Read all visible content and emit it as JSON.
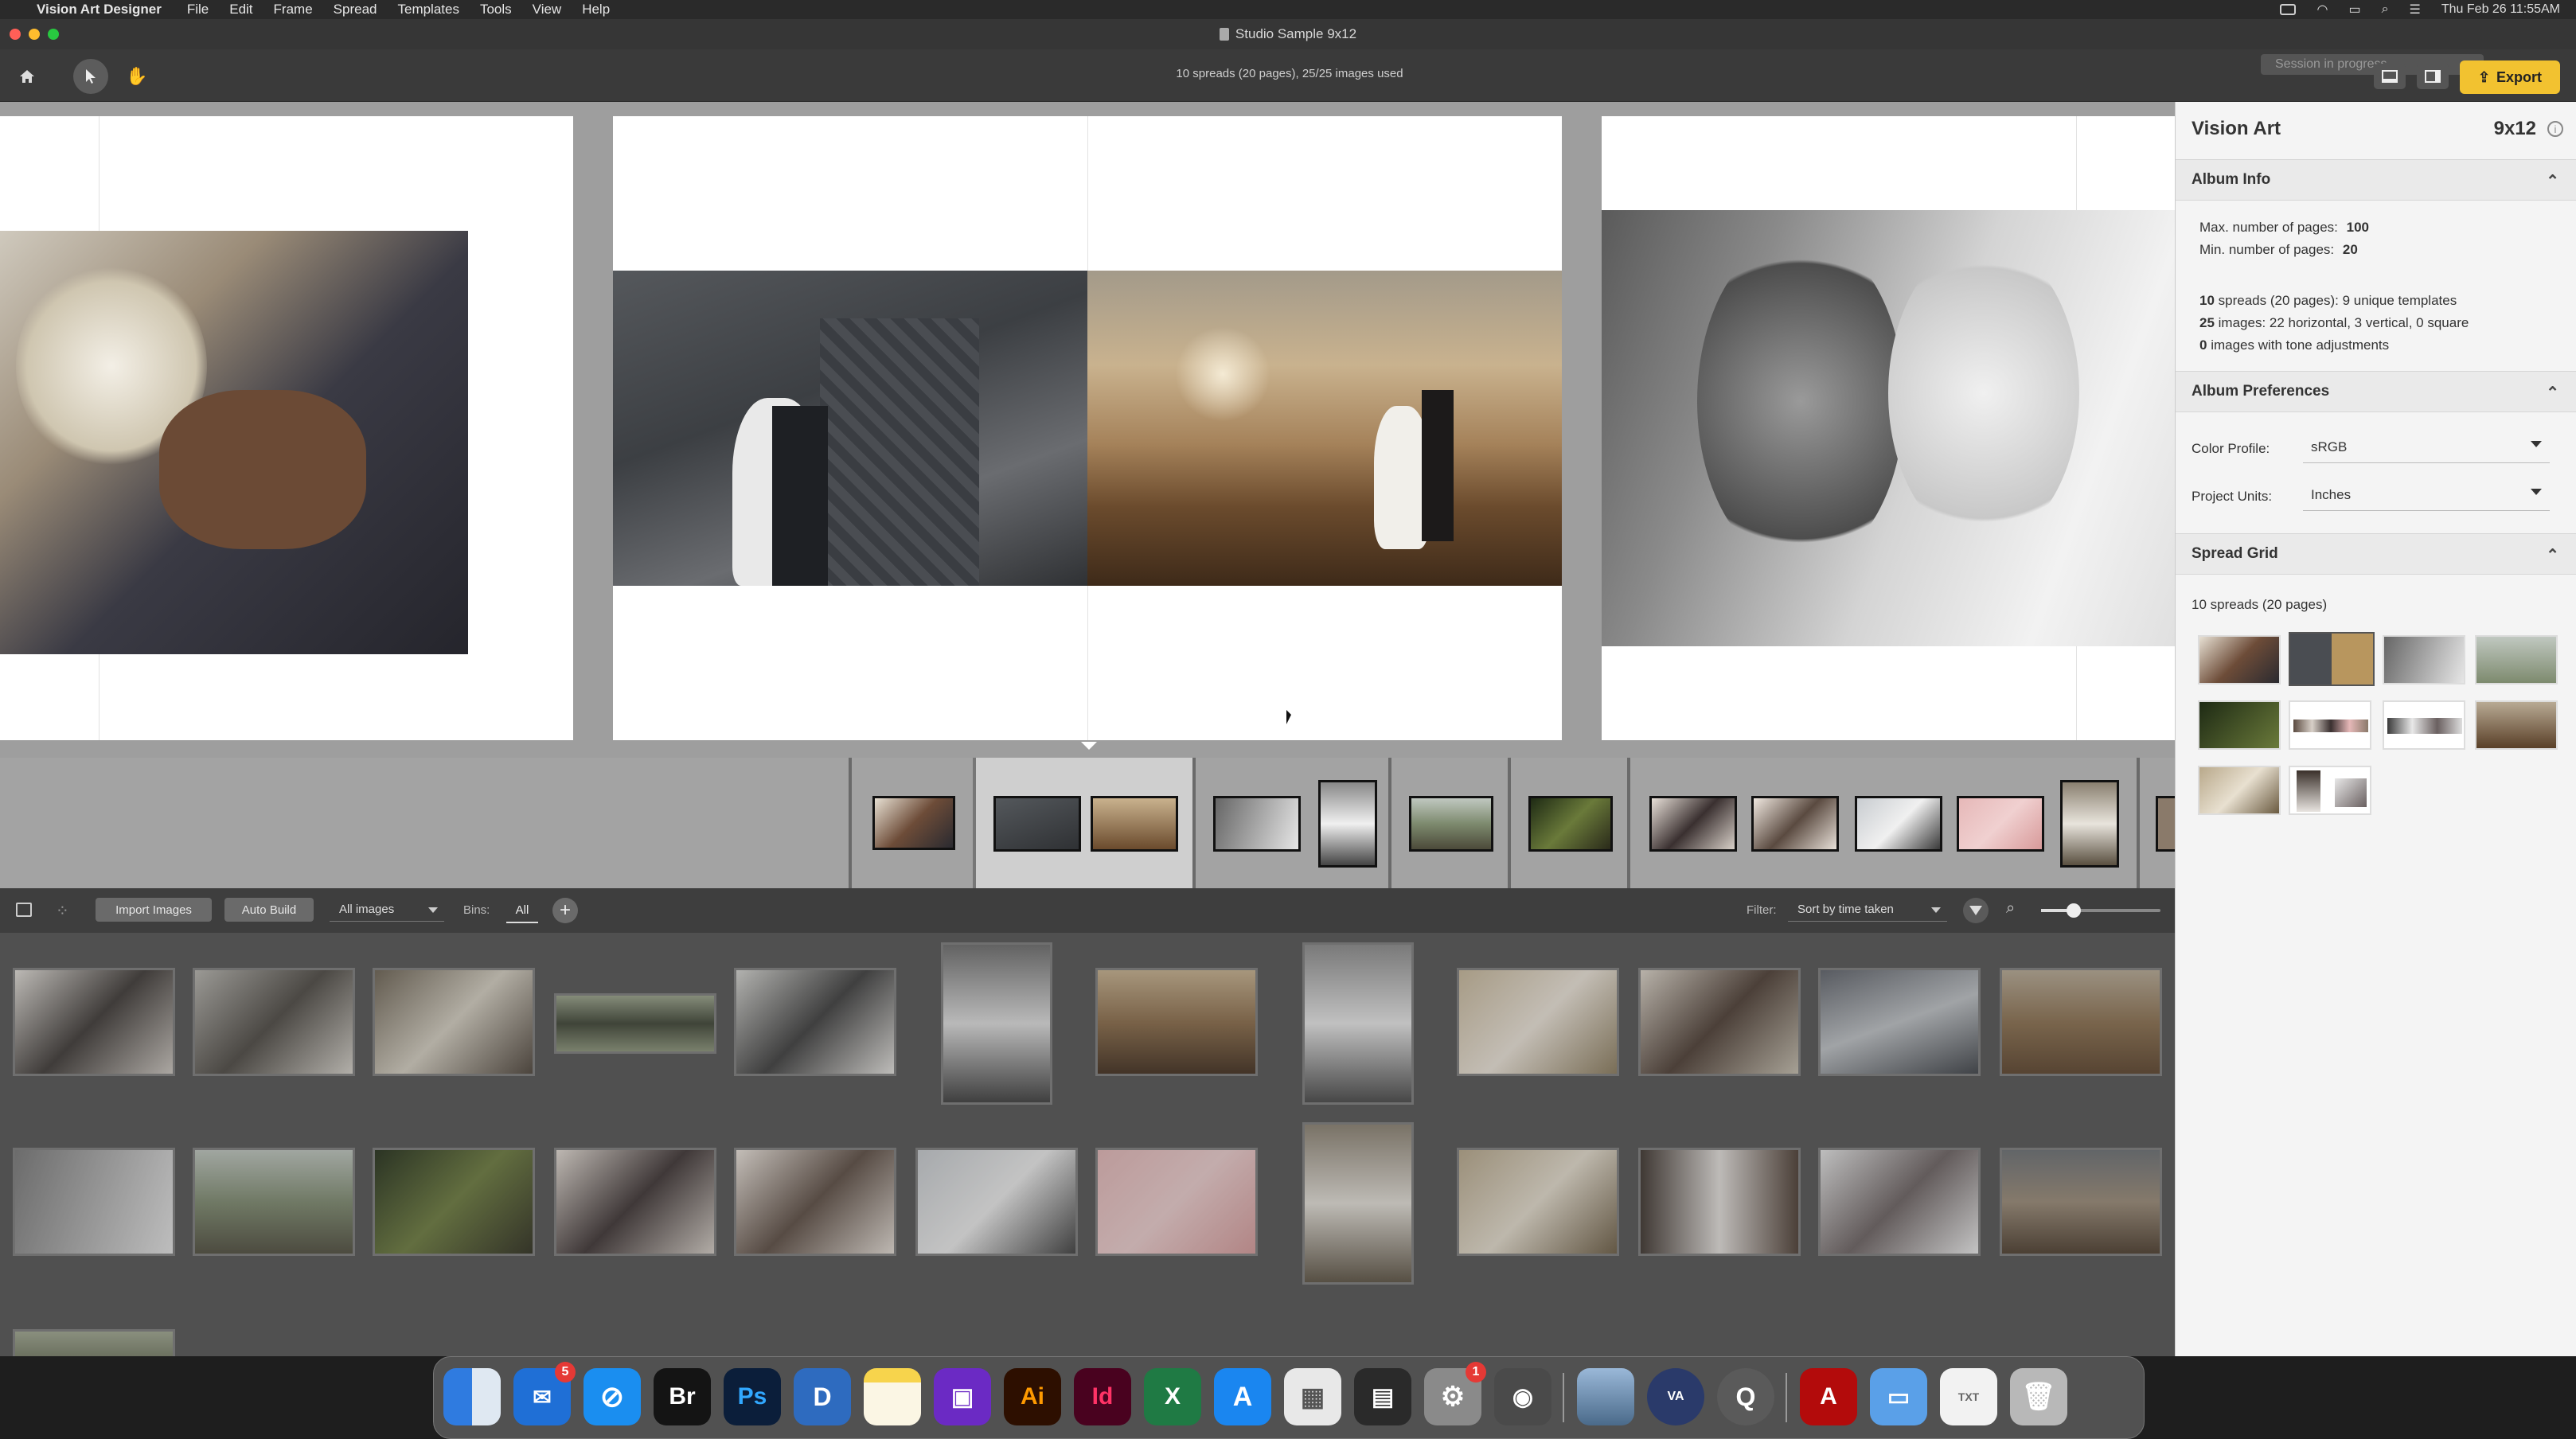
{
  "menubar": {
    "app_name": "Vision Art Designer",
    "items": [
      "File",
      "Edit",
      "Frame",
      "Spread",
      "Templates",
      "Tools",
      "View",
      "Help"
    ],
    "clock": "Thu Feb 26  11:55AM"
  },
  "window": {
    "title": "Studio Sample 9x12",
    "summary": "10 spreads (20 pages), 25/25 images used",
    "session_status": "Session in progress",
    "export_label": "Export"
  },
  "panel": {
    "brand": "Vision Art",
    "size": "9x12",
    "album_info": {
      "header": "Album Info",
      "max_pages_label": "Max. number of pages:",
      "max_pages_value": "100",
      "min_pages_label": "Min. number of pages:",
      "min_pages_value": "20",
      "spreads_num": "10",
      "spreads_text": " spreads (20 pages): 9 unique templates",
      "images_num": "25",
      "images_text": " images: 22 horizontal, 3 vertical, 0 square",
      "tone_num": "0",
      "tone_text": " images with tone adjustments"
    },
    "preferences": {
      "header": "Album Preferences",
      "color_profile_label": "Color Profile:",
      "color_profile_value": "sRGB",
      "units_label": "Project Units:",
      "units_value": "Inches"
    },
    "spread_grid": {
      "header": "Spread Grid",
      "caption": "10 spreads (20 pages)"
    }
  },
  "bins_bar": {
    "import_label": "Import Images",
    "auto_build_label": "Auto Build",
    "images_filter": "All images",
    "bins_label": "Bins:",
    "bin_all": "All",
    "filter_label": "Filter:",
    "sort_value": "Sort by time taken"
  },
  "dock": {
    "outlook_badge": "5",
    "settings_badge": "1"
  }
}
